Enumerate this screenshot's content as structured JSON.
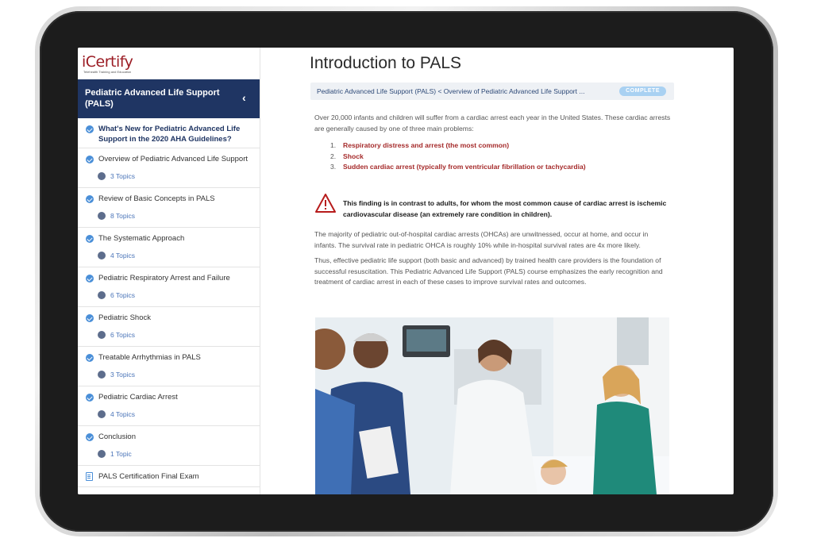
{
  "logo": {
    "text": "iCertify",
    "tagline": "Telehealth Training and Education"
  },
  "sidebar": {
    "course_title": "Pediatric Advanced Life Support (PALS)",
    "collapse_icon": "chevron-left-icon",
    "lessons": [
      {
        "label": "What's New for Pediatric Advanced Life Support in the 2020 AHA Guidelines?",
        "topics": ""
      },
      {
        "label": "Overview of Pediatric Advanced Life Support",
        "topics": "3 Topics"
      },
      {
        "label": "Review of Basic Concepts in PALS",
        "topics": "8 Topics"
      },
      {
        "label": "The Systematic Approach",
        "topics": "4 Topics"
      },
      {
        "label": "Pediatric Respiratory Arrest and Failure",
        "topics": "6 Topics"
      },
      {
        "label": "Pediatric Shock",
        "topics": "6 Topics"
      },
      {
        "label": "Treatable Arrhythmias in PALS",
        "topics": "3 Topics"
      },
      {
        "label": "Pediatric Cardiac Arrest",
        "topics": "4 Topics"
      },
      {
        "label": "Conclusion",
        "topics": "1 Topic"
      }
    ],
    "exam": {
      "label": "PALS Certification Final Exam"
    }
  },
  "main": {
    "title": "Introduction to PALS",
    "breadcrumb": "Pediatric Advanced Life Support (PALS) < Overview of Pediatric Advanced Life Support ...",
    "status": "COMPLETE",
    "intro": "Over 20,000 infants and children will suffer from a cardiac arrest each year in the United States.  These cardiac arrests are generally caused by one of three main problems:",
    "causes": [
      {
        "num": "1.",
        "text": "Respiratory distress and arrest (the most common)"
      },
      {
        "num": "2.",
        "text": "Shock"
      },
      {
        "num": "3.",
        "text": "Sudden cardiac arrest (typically from ventricular fibrillation or tachycardia)"
      }
    ],
    "warning": "This finding is in contrast to adults, for whom the most common cause of cardiac arrest is ischemic cardiovascular disease (an extremely rare condition in children).",
    "para1": "The majority of pediatric out-of-hospital cardiac arrests (OHCAs) are unwitnessed, occur at home, and occur in infants.  The survival rate in pediatric OHCA is roughly 10% while in-hospital survival rates are 4x more likely.",
    "para2": "Thus, effective pediatric life support (both basic and advanced) by trained health care providers is the foundation of successful resuscitation. This Pediatric Advanced Life Support (PALS) course emphasizes the early recognition and treatment of cardiac arrest in each of these cases to improve survival rates and outcomes."
  },
  "colors": {
    "sidebar_header": "#1f3563",
    "check": "#4a8fd8",
    "cause_text": "#a52a2a",
    "warning_icon": "#b71c1c",
    "badge": "#a9d1f2"
  }
}
